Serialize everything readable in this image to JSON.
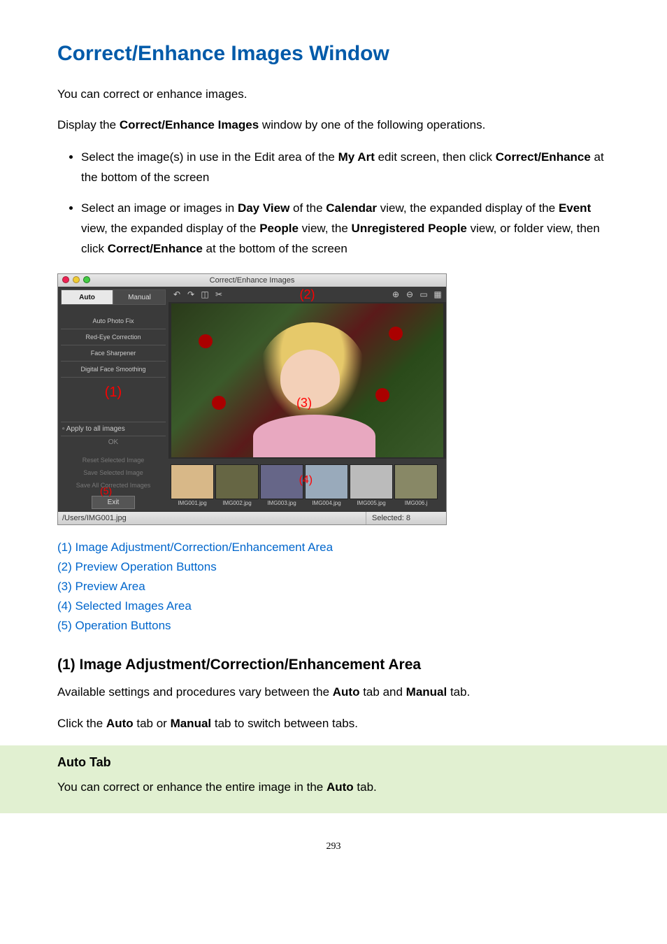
{
  "title": "Correct/Enhance Images Window",
  "intro1": "You can correct or enhance images.",
  "intro2_pre": "Display the ",
  "intro2_bold": "Correct/Enhance Images",
  "intro2_post": " window by one of the following operations.",
  "bullets": [
    {
      "parts": [
        {
          "t": "Select the image(s) in use in the Edit area of the "
        },
        {
          "t": "My Art",
          "b": true
        },
        {
          "t": " edit screen, then click "
        },
        {
          "t": "Correct/Enhance",
          "b": true
        },
        {
          "t": " at the bottom of the screen"
        }
      ]
    },
    {
      "parts": [
        {
          "t": "Select an image or images in "
        },
        {
          "t": "Day View",
          "b": true
        },
        {
          "t": " of the "
        },
        {
          "t": "Calendar",
          "b": true
        },
        {
          "t": " view, the expanded display of the "
        },
        {
          "t": "Event",
          "b": true
        },
        {
          "t": " view, the expanded display of the "
        },
        {
          "t": "People",
          "b": true
        },
        {
          "t": " view, the "
        },
        {
          "t": "Unregistered People",
          "b": true
        },
        {
          "t": " view, or folder view, then click "
        },
        {
          "t": "Correct/Enhance",
          "b": true
        },
        {
          "t": " at the bottom of the screen"
        }
      ]
    }
  ],
  "screenshot": {
    "window_title": "Correct/Enhance Images",
    "tabs": {
      "auto": "Auto",
      "manual": "Manual"
    },
    "options": [
      "Auto Photo Fix",
      "Red-Eye Correction",
      "Face Sharpener",
      "Digital Face Smoothing"
    ],
    "apply_all": "Apply to all images",
    "ok": "OK",
    "reset": "Reset Selected Image",
    "save_sel": "Save Selected Image",
    "save_all": "Save All Corrected Images",
    "exit": "Exit",
    "markers": {
      "m1": "(1)",
      "m2": "(2)",
      "m3": "(3)",
      "m4": "(4)",
      "m5": "(5)"
    },
    "toolbar_left": [
      "rotate-left-icon",
      "rotate-right-icon",
      "compare-icon",
      "crop-icon"
    ],
    "toolbar_left_glyphs": [
      "↶",
      "↷",
      "◫",
      "✂"
    ],
    "toolbar_right": [
      "zoom-in-icon",
      "zoom-out-icon",
      "fit-icon",
      "actual-icon"
    ],
    "toolbar_right_glyphs": [
      "⊕",
      "⊖",
      "▭",
      "▦"
    ],
    "thumbs": [
      "IMG001.jpg",
      "IMG002.jpg",
      "IMG003.jpg",
      "IMG004.jpg",
      "IMG005.jpg",
      "IMG006.j"
    ],
    "status_path": "/Users/IMG001.jpg",
    "status_selected": "Selected: 8"
  },
  "links": [
    "(1) Image Adjustment/Correction/Enhancement Area",
    "(2) Preview Operation Buttons",
    "(3) Preview Area",
    "(4) Selected Images Area",
    "(5) Operation Buttons"
  ],
  "section1_heading": "(1) Image Adjustment/Correction/Enhancement Area",
  "section1_p1_pre": "Available settings and procedures vary between the ",
  "section1_p1_b1": "Auto",
  "section1_p1_mid": " tab and ",
  "section1_p1_b2": "Manual",
  "section1_p1_post": " tab.",
  "section1_p2_pre": "Click the ",
  "section1_p2_b1": "Auto",
  "section1_p2_mid": " tab or ",
  "section1_p2_b2": "Manual",
  "section1_p2_post": " tab to switch between tabs.",
  "green_heading": "Auto Tab",
  "green_p_pre": "You can correct or enhance the entire image in the ",
  "green_p_b": "Auto",
  "green_p_post": " tab.",
  "page_number": "293"
}
